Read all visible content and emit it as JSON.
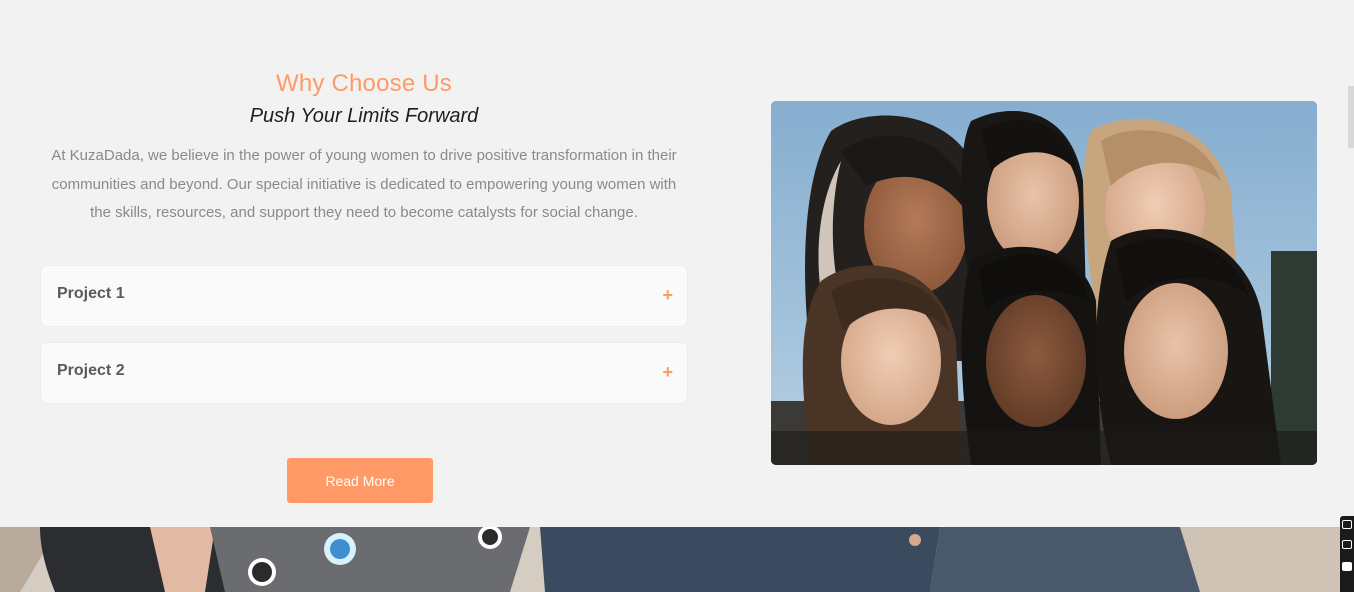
{
  "section": {
    "eyebrow": "Why Choose Us",
    "subtitle": "Push Your Limits Forward",
    "intro_lines": [
      "At KuzaDada, we believe in the power of young women to drive positive transformation in their",
      "communities and beyond. Our special initiative is dedicated to empowering young women with",
      "the skills, resources, and support they need to become catalysts for social change."
    ]
  },
  "accordion": {
    "items": [
      {
        "label": "Project 1",
        "icon": "+"
      },
      {
        "label": "Project 2",
        "icon": "+"
      }
    ]
  },
  "cta": {
    "label": "Read More"
  },
  "image": {
    "subject": "group-of-six-young-women-photo",
    "background_image": "laptop-with-stickers-photo"
  },
  "colors": {
    "accent": "#ff9a66",
    "background": "#f2f2f2",
    "card": "#fafafa",
    "body_text": "#8a8a8a",
    "heading_text": "#1e1e1e"
  }
}
